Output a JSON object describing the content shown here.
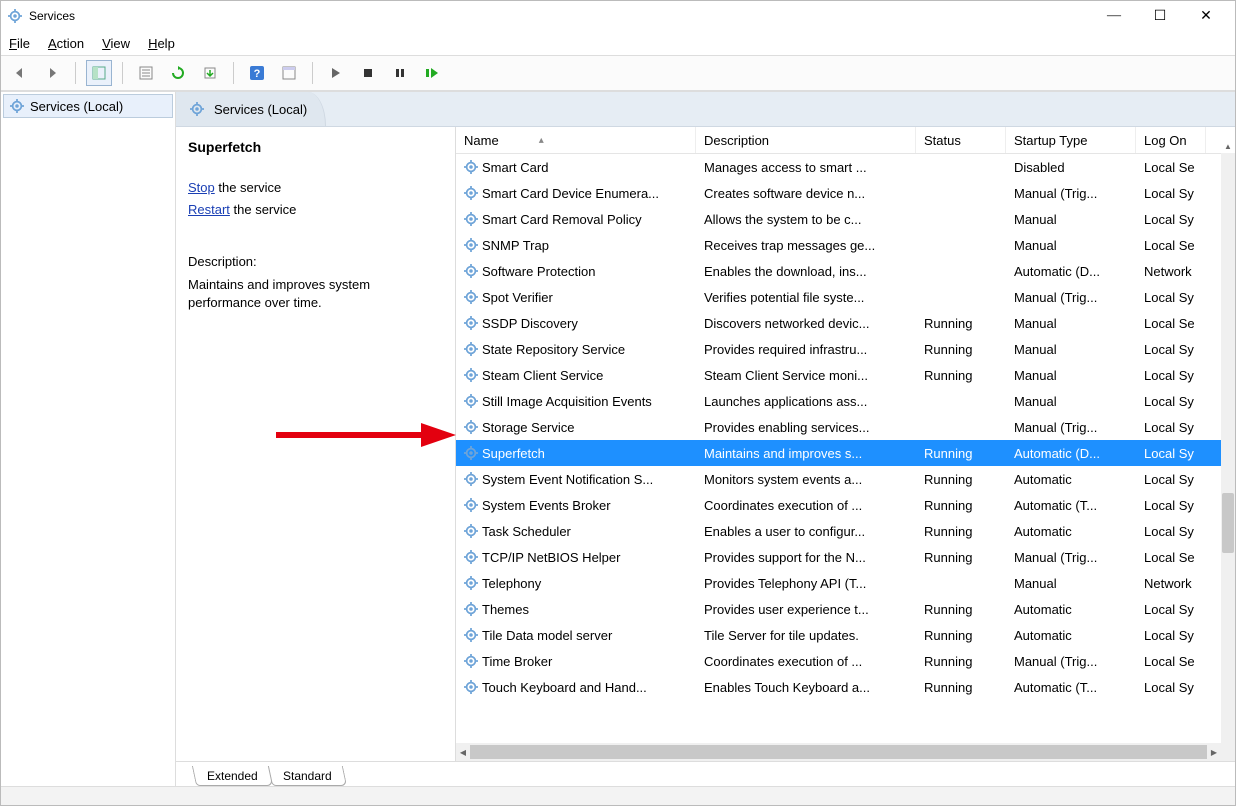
{
  "window": {
    "title": "Services"
  },
  "menu": {
    "file": "File",
    "action": "Action",
    "view": "View",
    "help": "Help"
  },
  "tree": {
    "root": "Services (Local)"
  },
  "paneTab": "Services (Local)",
  "detail": {
    "heading": "Superfetch",
    "stop_link": "Stop",
    "stop_tail": " the service",
    "restart_link": "Restart",
    "restart_tail": " the service",
    "desc_label": "Description:",
    "desc_text": "Maintains and improves system performance over time."
  },
  "columns": {
    "name": "Name",
    "desc": "Description",
    "status": "Status",
    "startup": "Startup Type",
    "logon": "Log On"
  },
  "rows": [
    {
      "name": "Smart Card",
      "desc": "Manages access to smart ...",
      "status": "",
      "startup": "Disabled",
      "logon": "Local Se",
      "sel": false
    },
    {
      "name": "Smart Card Device Enumera...",
      "desc": "Creates software device n...",
      "status": "",
      "startup": "Manual (Trig...",
      "logon": "Local Sy",
      "sel": false
    },
    {
      "name": "Smart Card Removal Policy",
      "desc": "Allows the system to be c...",
      "status": "",
      "startup": "Manual",
      "logon": "Local Sy",
      "sel": false
    },
    {
      "name": "SNMP Trap",
      "desc": "Receives trap messages ge...",
      "status": "",
      "startup": "Manual",
      "logon": "Local Se",
      "sel": false
    },
    {
      "name": "Software Protection",
      "desc": "Enables the download, ins...",
      "status": "",
      "startup": "Automatic (D...",
      "logon": "Network",
      "sel": false
    },
    {
      "name": "Spot Verifier",
      "desc": "Verifies potential file syste...",
      "status": "",
      "startup": "Manual (Trig...",
      "logon": "Local Sy",
      "sel": false
    },
    {
      "name": "SSDP Discovery",
      "desc": "Discovers networked devic...",
      "status": "Running",
      "startup": "Manual",
      "logon": "Local Se",
      "sel": false
    },
    {
      "name": "State Repository Service",
      "desc": "Provides required infrastru...",
      "status": "Running",
      "startup": "Manual",
      "logon": "Local Sy",
      "sel": false
    },
    {
      "name": "Steam Client Service",
      "desc": "Steam Client Service moni...",
      "status": "Running",
      "startup": "Manual",
      "logon": "Local Sy",
      "sel": false
    },
    {
      "name": "Still Image Acquisition Events",
      "desc": "Launches applications ass...",
      "status": "",
      "startup": "Manual",
      "logon": "Local Sy",
      "sel": false
    },
    {
      "name": "Storage Service",
      "desc": "Provides enabling services...",
      "status": "",
      "startup": "Manual (Trig...",
      "logon": "Local Sy",
      "sel": false
    },
    {
      "name": "Superfetch",
      "desc": "Maintains and improves s...",
      "status": "Running",
      "startup": "Automatic (D...",
      "logon": "Local Sy",
      "sel": true
    },
    {
      "name": "System Event Notification S...",
      "desc": "Monitors system events a...",
      "status": "Running",
      "startup": "Automatic",
      "logon": "Local Sy",
      "sel": false
    },
    {
      "name": "System Events Broker",
      "desc": "Coordinates execution of ...",
      "status": "Running",
      "startup": "Automatic (T...",
      "logon": "Local Sy",
      "sel": false
    },
    {
      "name": "Task Scheduler",
      "desc": "Enables a user to configur...",
      "status": "Running",
      "startup": "Automatic",
      "logon": "Local Sy",
      "sel": false
    },
    {
      "name": "TCP/IP NetBIOS Helper",
      "desc": "Provides support for the N...",
      "status": "Running",
      "startup": "Manual (Trig...",
      "logon": "Local Se",
      "sel": false
    },
    {
      "name": "Telephony",
      "desc": "Provides Telephony API (T...",
      "status": "",
      "startup": "Manual",
      "logon": "Network",
      "sel": false
    },
    {
      "name": "Themes",
      "desc": "Provides user experience t...",
      "status": "Running",
      "startup": "Automatic",
      "logon": "Local Sy",
      "sel": false
    },
    {
      "name": "Tile Data model server",
      "desc": "Tile Server for tile updates.",
      "status": "Running",
      "startup": "Automatic",
      "logon": "Local Sy",
      "sel": false
    },
    {
      "name": "Time Broker",
      "desc": "Coordinates execution of ...",
      "status": "Running",
      "startup": "Manual (Trig...",
      "logon": "Local Se",
      "sel": false
    },
    {
      "name": "Touch Keyboard and Hand...",
      "desc": "Enables Touch Keyboard a...",
      "status": "Running",
      "startup": "Automatic (T...",
      "logon": "Local Sy",
      "sel": false
    }
  ],
  "tabs": {
    "extended": "Extended",
    "standard": "Standard"
  }
}
